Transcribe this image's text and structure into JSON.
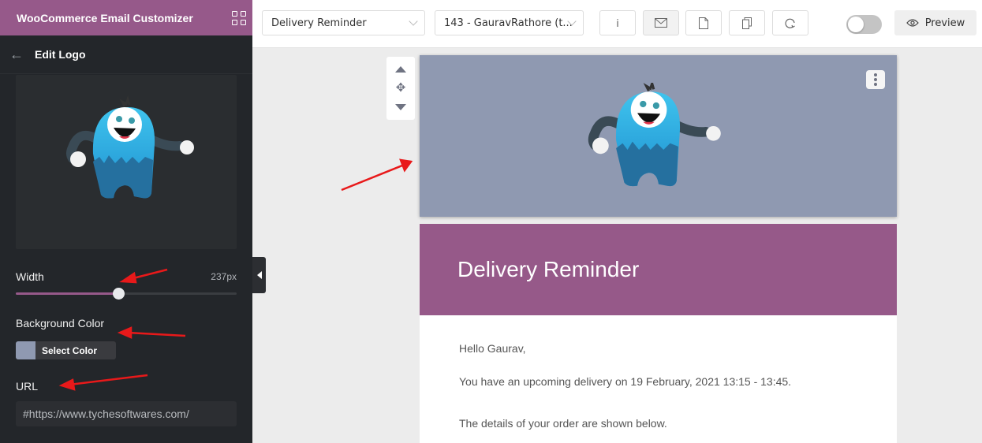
{
  "app": {
    "title": "WooCommerce Email Customizer"
  },
  "sidebar": {
    "back_label": "Edit Logo",
    "width": {
      "label": "Width",
      "value_text": "237px",
      "fraction": 0.465
    },
    "background_color": {
      "label": "Background Color",
      "button_label": "Select Color",
      "value": "#8f99b1"
    },
    "url": {
      "label": "URL",
      "value": "#https://www.tychesoftwares.com/"
    }
  },
  "toolbar": {
    "template_select": "Delivery Reminder",
    "order_select": "143 - GauravRathore (t...",
    "buttons": [
      {
        "icon": "info-icon",
        "glyph": "i"
      },
      {
        "icon": "mail-icon",
        "glyph": "✉"
      },
      {
        "icon": "document-icon",
        "glyph": "🗋"
      },
      {
        "icon": "copy-icon",
        "glyph": "❐"
      },
      {
        "icon": "reset-icon",
        "glyph": "↻"
      }
    ],
    "toggle_on": false,
    "preview_label": "Preview"
  },
  "email": {
    "logo_background": "#8f99b1",
    "header_background": "#965989",
    "header_title": "Delivery Reminder",
    "body_lines": [
      "Hello Gaurav,",
      "You have an upcoming delivery on 19 February, 2021 13:15 - 13:45.",
      "The details of your order are shown below."
    ]
  },
  "colors": {
    "brand": "#96598a",
    "annotation_arrow": "#e8191a"
  }
}
